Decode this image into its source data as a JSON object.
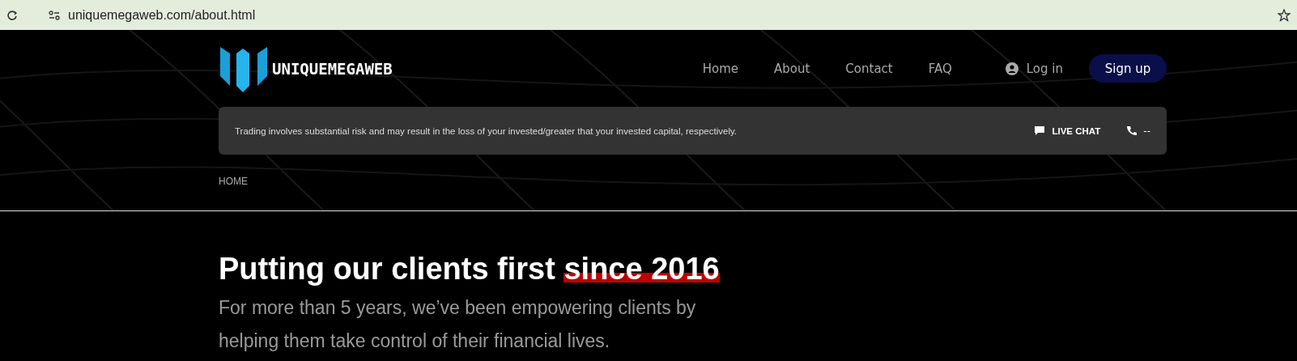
{
  "browser": {
    "url": "uniquemegaweb.com/about.html"
  },
  "header": {
    "logo": "UNIQUEMEGAWEB",
    "nav": [
      {
        "label": "Home"
      },
      {
        "label": "About"
      },
      {
        "label": "Contact"
      },
      {
        "label": "FAQ"
      }
    ],
    "login": "Log in",
    "signup": "Sign up"
  },
  "notice": {
    "text": "Trading involves substantial risk and may result in the loss of your invested/greater that your invested capital, respectively.",
    "live_chat": "LIVE CHAT",
    "phone": "--"
  },
  "breadcrumb": "HOME",
  "hero": {
    "title": "Putting our clients first ",
    "highlight": "since 2016",
    "subtitle": "For more than 5 years, we’ve been empowering clients by helping them take control of their financial lives."
  }
}
